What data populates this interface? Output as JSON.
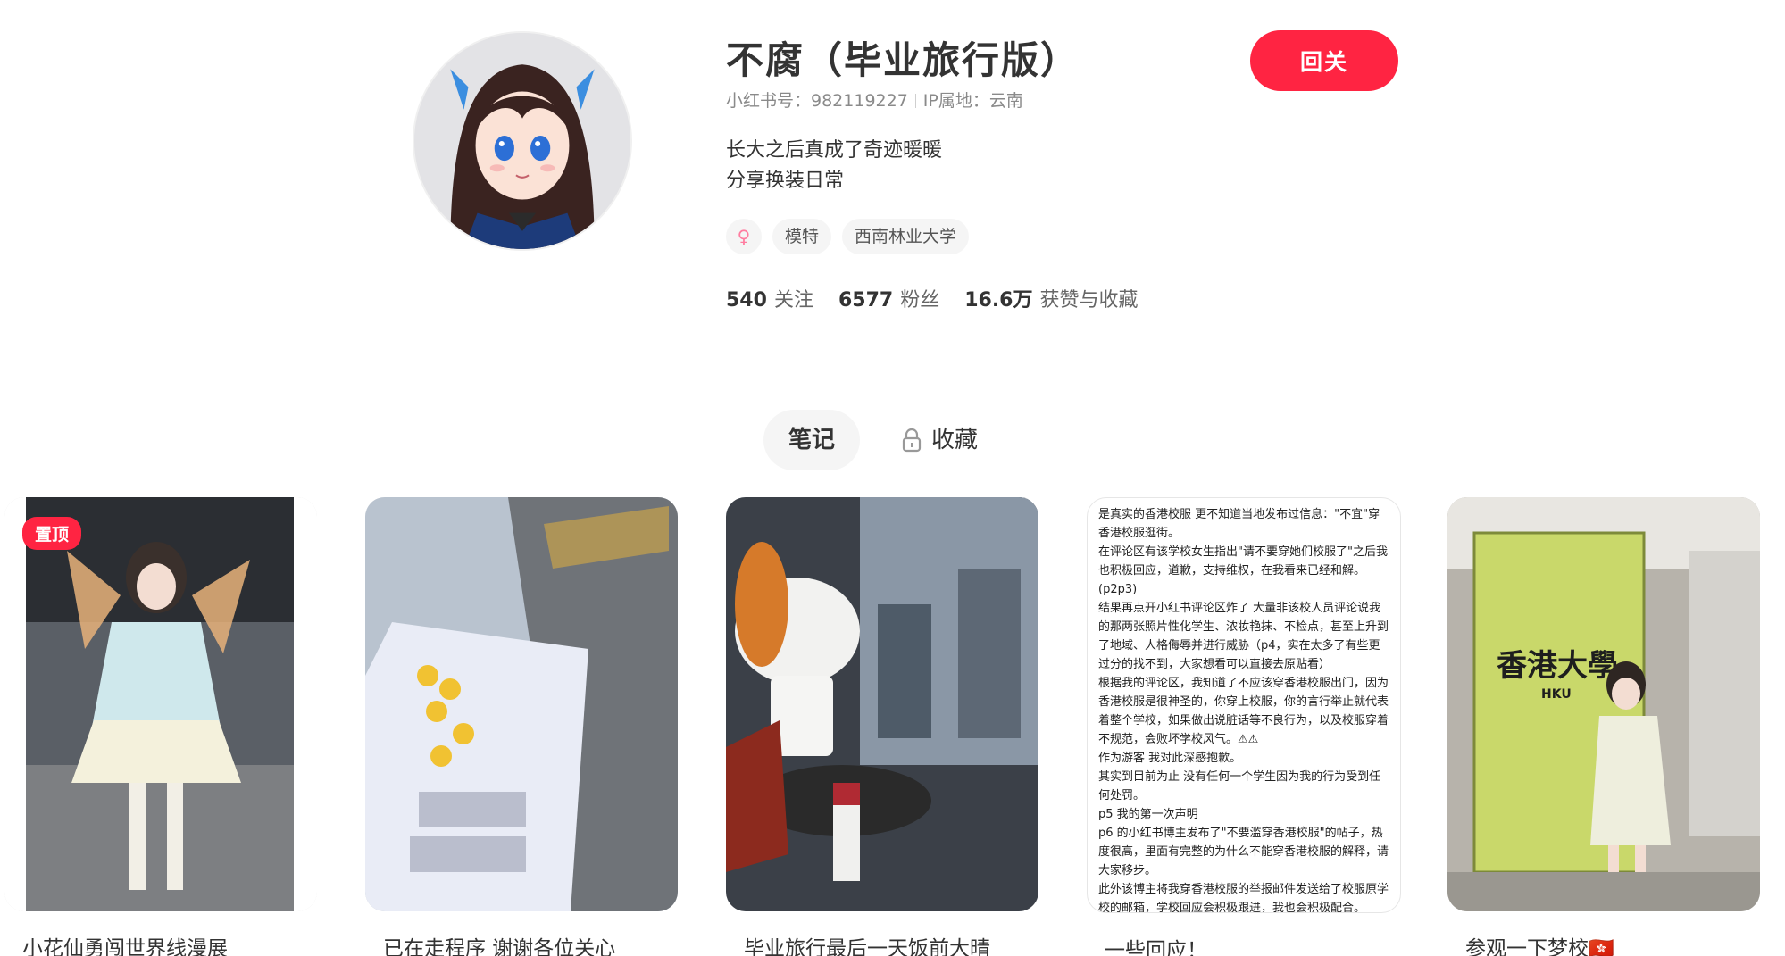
{
  "profile": {
    "name": "不腐（毕业旅行版）",
    "id_label": "小红书号：982119227",
    "ip_label": "IP属地：云南",
    "bio_lines": [
      "长大之后真成了奇迹暖暖",
      "分享换装日常"
    ],
    "gender_symbol": "♀",
    "tags": [
      "模特",
      "西南林业大学"
    ],
    "stats": [
      {
        "value": "540",
        "label": "关注"
      },
      {
        "value": "6577",
        "label": "粉丝"
      },
      {
        "value": "16.6万",
        "label": "获赞与收藏"
      }
    ],
    "follow_button": "回关"
  },
  "tabs": [
    {
      "label": "笔记",
      "active": true
    },
    {
      "label": "收藏",
      "locked": true
    }
  ],
  "notes": [
    {
      "title": "小花仙勇闯世界线漫展",
      "pinned_label": "置顶"
    },
    {
      "title": "已在走程序 谢谢各位关心"
    },
    {
      "title": "毕业旅行最后一天饭前大晴"
    },
    {
      "title": "一些回应！",
      "text_lines": [
        "是真实的香港校服 更不知道当地发布过信息：\"不宜\"穿香港校服逛街。",
        "在评论区有该学校女生指出\"请不要穿她们校服了\"之后我也积极回应，道歉，支持维权，在我看来已经和解。",
        "(p2p3)",
        "结果再点开小红书评论区炸了 大量非该校人员评论说我的那两张照片性化学生、浓妆艳抹、不检点，甚至上升到了地域、人格侮辱并进行威胁（p4，实在太多了有些更过分的找不到，大家想看可以直接去原贴看）",
        "根据我的评论区，我知道了不应该穿香港校服出门，因为香港校服是很神圣的，你穿上校服，你的言行举止就代表着整个学校，如果做出说脏话等不良行为，以及校服穿着不规范，会败坏学校风气。⚠⚠",
        "作为游客 我对此深感抱歉。",
        "其实到目前为止 没有任何一个学生因为我的行为受到任何处罚。",
        "p5 我的第一次声明",
        "p6 的小红书博主发布了\"不要滥穿香港校服\"的帖子，热度很高，里面有完整的为什么不能穿香港校服的解释，请大家移步。",
        "此外该博主将我穿香港校服的举报邮件发送给了校服原学校的邮箱，学校回应会积极跟进，我也会积极配合。"
      ]
    },
    {
      "title": "参观一下梦校🇭🇰",
      "sign_text": "香港大學",
      "sign_sub": "HKU"
    }
  ],
  "colors": {
    "brand_red": "#ff2442",
    "text_primary": "#333333",
    "text_secondary": "#8a8a8a",
    "tag_bg": "#f5f5f5"
  },
  "icons": [
    "lock-icon",
    "female-icon"
  ]
}
